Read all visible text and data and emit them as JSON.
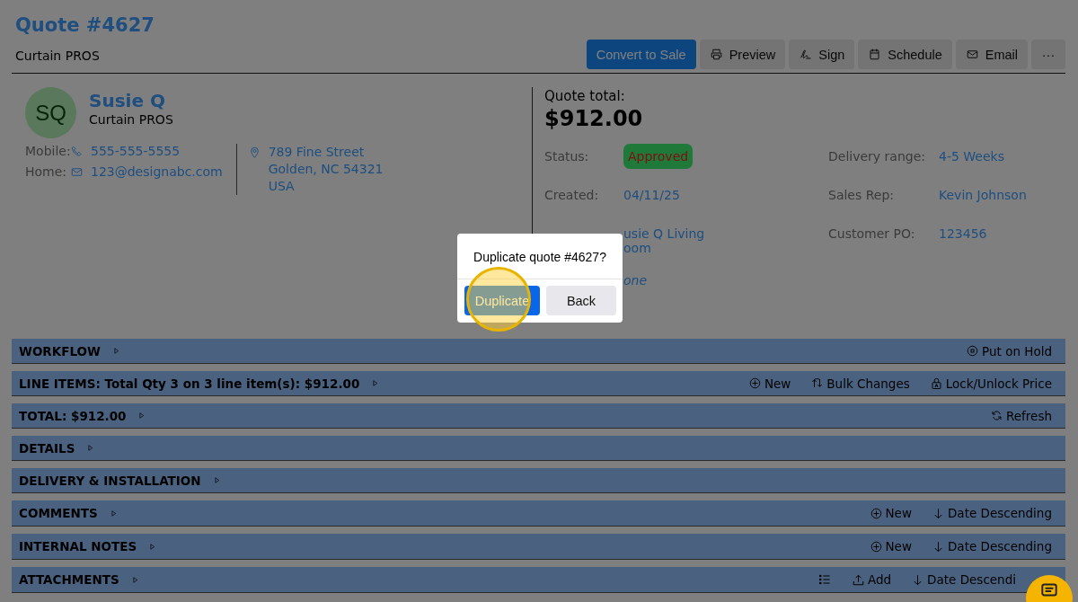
{
  "header": {
    "title": "Quote #4627",
    "subtitle": "Curtain PROS"
  },
  "toolbar": [
    {
      "label": "Convert to Sale",
      "kind": "primary"
    },
    {
      "label": "Preview",
      "kind": "printer"
    },
    {
      "label": "Sign",
      "kind": "signature"
    },
    {
      "label": "Schedule",
      "kind": "calendar"
    },
    {
      "label": "Email",
      "kind": "mail"
    },
    {
      "label": "···",
      "kind": "more"
    }
  ],
  "customer": {
    "initials": "SQ",
    "name": "Susie Q",
    "company": "Curtain PROS",
    "contacts": [
      {
        "label": "Mobile:",
        "kind": "phone",
        "value": "555-555-5555"
      },
      {
        "label": "Home:",
        "kind": "mail",
        "value": "123@designabc.com"
      }
    ],
    "address": [
      "789 Fine Street",
      "Golden, NC 54321",
      "USA"
    ]
  },
  "summary": {
    "total_label": "Quote total:",
    "total": "$912.00",
    "left": [
      {
        "label": "Status:",
        "kind": "badge",
        "lines": [
          "Approved"
        ]
      },
      {
        "label": "Created:",
        "kind": "link",
        "lines": [
          "04/11/25"
        ]
      },
      {
        "kind": "link",
        "lines": [
          "usie Q Living",
          "oom"
        ]
      },
      {
        "kind": "italic",
        "lines": [
          "one"
        ]
      }
    ],
    "right": [
      {
        "label": "Delivery range:",
        "kind": "link",
        "lines": [
          "4-5 Weeks"
        ]
      },
      {
        "label": "Sales Rep:",
        "kind": "link",
        "lines": [
          "Kevin Johnson"
        ]
      },
      {
        "label": "Customer PO:",
        "kind": "link",
        "lines": [
          "123456"
        ]
      }
    ]
  },
  "sections": [
    {
      "title": "WORKFLOW",
      "actions": [
        {
          "kind": "pause",
          "label": "Put on Hold"
        }
      ]
    },
    {
      "title": "LINE ITEMS: Total Qty 3 on 3 line item(s): $912.00",
      "actions": [
        {
          "kind": "plus",
          "label": "New"
        },
        {
          "kind": "swap",
          "label": "Bulk Changes"
        },
        {
          "kind": "lock",
          "label": "Lock/Unlock Price"
        }
      ]
    },
    {
      "title": "TOTAL: $912.00",
      "actions": [
        {
          "kind": "refresh",
          "label": "Refresh"
        }
      ]
    },
    {
      "title": "DETAILS"
    },
    {
      "title": "DELIVERY & INSTALLATION"
    },
    {
      "title": "COMMENTS",
      "actions": [
        {
          "kind": "plus",
          "label": "New"
        },
        {
          "kind": "down",
          "label": "Date Descending"
        }
      ]
    },
    {
      "title": "INTERNAL NOTES",
      "actions": [
        {
          "kind": "plus",
          "label": "New"
        },
        {
          "kind": "down",
          "label": "Date Descending"
        }
      ]
    },
    {
      "title": "ATTACHMENTS",
      "actions": [
        {
          "kind": "list"
        },
        {
          "kind": "upload",
          "label": "Add"
        },
        {
          "kind": "down",
          "label": "Date Descendi"
        }
      ]
    }
  ],
  "dialog": {
    "message": "Duplicate quote #4627?",
    "buttons": [
      {
        "label": "Duplicate",
        "kind": "primary",
        "highlighted": true
      },
      {
        "label": "Back",
        "kind": "secondary",
        "highlighted": false
      }
    ]
  },
  "help_button": {
    "kind": "chat"
  }
}
